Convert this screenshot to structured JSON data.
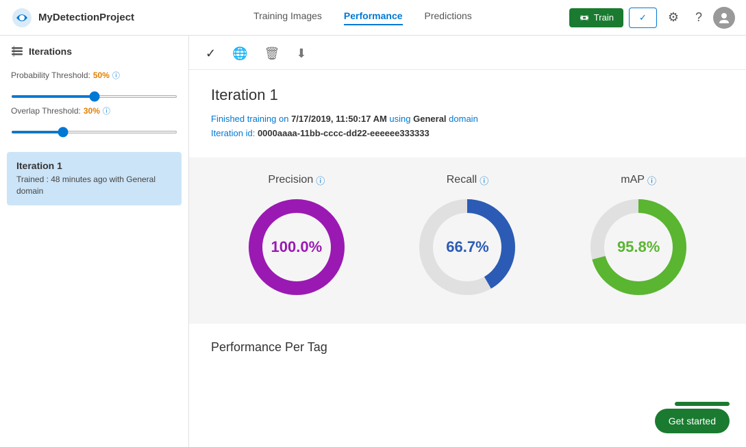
{
  "app": {
    "title": "MyDetectionProject",
    "logo_alt": "Custom Vision logo"
  },
  "header": {
    "nav": [
      {
        "label": "Training Images",
        "active": false
      },
      {
        "label": "Performance",
        "active": true
      },
      {
        "label": "Predictions",
        "active": false
      }
    ],
    "train_button": "Train",
    "checkmark_label": "✓",
    "settings_label": "⚙",
    "help_label": "?",
    "avatar_label": "User"
  },
  "sidebar": {
    "header": "Iterations",
    "probability_threshold_label": "Probability Threshold:",
    "probability_threshold_value": "50%",
    "overlap_threshold_label": "Overlap Threshold:",
    "overlap_threshold_value": "30%",
    "probability_slider_value": 50,
    "overlap_slider_value": 30,
    "iteration": {
      "title": "Iteration 1",
      "description": "Trained : 48 minutes ago with General domain"
    }
  },
  "toolbar": {
    "checkmark": "✓",
    "globe": "🌐",
    "delete": "🗑",
    "download": "⬇"
  },
  "main": {
    "iteration_name": "Iteration 1",
    "meta_line1_prefix": "Finished training on ",
    "meta_date": "7/17/2019, 11:50:17 AM",
    "meta_domain_prefix": " using ",
    "meta_domain": "General",
    "meta_domain_suffix": " domain",
    "meta_line2_prefix": "Iteration id: ",
    "meta_iteration_id": "0000aaaa-11bb-cccc-dd22-eeeeee333333",
    "metrics": [
      {
        "id": "precision",
        "label": "Precision",
        "value": "100.0%",
        "color": "#9b19b3",
        "percentage": 100,
        "text_color": "#9b19b3"
      },
      {
        "id": "recall",
        "label": "Recall",
        "value": "66.7%",
        "color": "#2b5bb5",
        "percentage": 66.7,
        "text_color": "#2b5bb5"
      },
      {
        "id": "map",
        "label": "mAP",
        "value": "95.8%",
        "color": "#5ab531",
        "percentage": 95.8,
        "text_color": "#5ab531"
      }
    ],
    "perf_per_tag_title": "Performance Per Tag",
    "get_started_label": "Get started"
  },
  "colors": {
    "accent_blue": "#0078d4",
    "accent_green": "#1a7b30",
    "precision_color": "#9b19b3",
    "recall_color": "#2b5bb5",
    "map_color": "#5ab531"
  }
}
